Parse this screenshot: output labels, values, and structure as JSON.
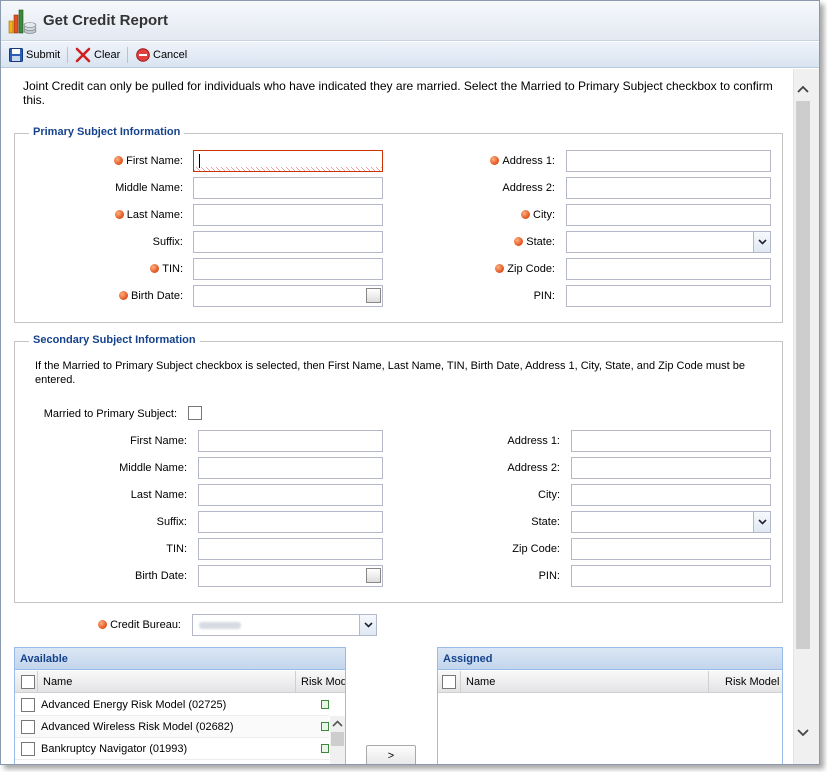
{
  "window": {
    "title": "Get Credit Report"
  },
  "toolbar": {
    "submit": "Submit",
    "clear": "Clear",
    "cancel": "Cancel"
  },
  "intro": "Joint Credit can only be pulled for individuals who have indicated they are married. Select the Married to Primary Subject checkbox to confirm this.",
  "primary": {
    "legend": "Primary Subject Information",
    "first_name": "First Name:",
    "middle_name": "Middle Name:",
    "last_name": "Last Name:",
    "suffix": "Suffix:",
    "tin": "TIN:",
    "birth_date": "Birth Date:",
    "address1": "Address 1:",
    "address2": "Address 2:",
    "city": "City:",
    "state": "State:",
    "zip": "Zip Code:",
    "pin": "PIN:"
  },
  "secondary": {
    "legend": "Secondary Subject Information",
    "note": "If the Married to Primary Subject checkbox is selected, then First Name, Last Name, TIN, Birth Date, Address 1, City, State, and Zip Code must be entered.",
    "married": "Married to Primary Subject:",
    "first_name": "First Name:",
    "middle_name": "Middle Name:",
    "last_name": "Last Name:",
    "suffix": "Suffix:",
    "tin": "TIN:",
    "birth_date": "Birth Date:",
    "address1": "Address 1:",
    "address2": "Address 2:",
    "city": "City:",
    "state": "State:",
    "zip": "Zip Code:",
    "pin": "PIN:"
  },
  "bureau": {
    "label": "Credit Bureau:",
    "value": ""
  },
  "available": {
    "title": "Available",
    "col_name": "Name",
    "col_risk": "Risk Model",
    "rows": [
      "Advanced Energy Risk Model (02725)",
      "Advanced Wireless Risk Model (02682)",
      "Bankruptcy Navigator (01993)"
    ]
  },
  "assigned": {
    "title": "Assigned",
    "col_name": "Name",
    "col_risk": "Risk Model"
  },
  "move_button": ">",
  "colors": {
    "accent": "#15428b",
    "required": "#e0501a",
    "panel_border": "#99bbe8"
  }
}
